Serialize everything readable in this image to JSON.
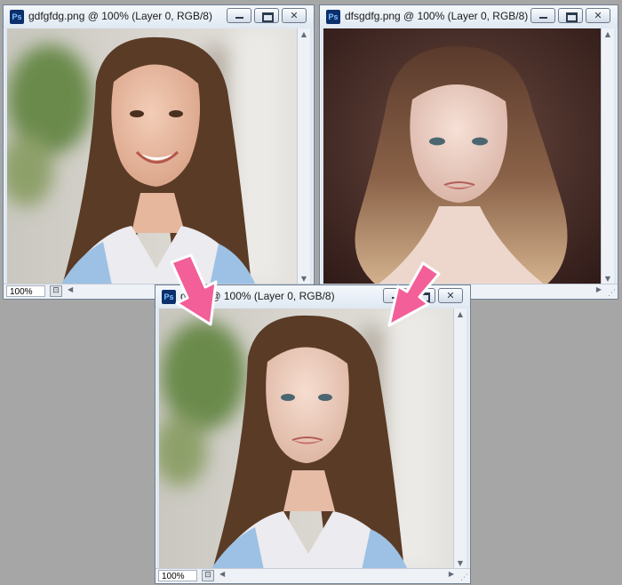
{
  "windows": [
    {
      "id": "win-source",
      "title": "gdfgfdg.png @ 100% (Layer 0, RGB/8)",
      "zoom": "100%",
      "icon": "photoshop-document-icon",
      "image": "portrait of smiling long-haired woman"
    },
    {
      "id": "win-face",
      "title": "dfsgdfg.png @ 100% (Layer 0, RGB/8)",
      "zoom": "",
      "icon": "photoshop-document-icon",
      "image": "portrait of woman with curly blonde-tipped hair"
    },
    {
      "id": "win-result",
      "title": "g.png @ 100% (Layer 0, RGB/8)",
      "zoom": "100%",
      "icon": "photoshop-document-icon",
      "image": "composited face-swapped portrait"
    }
  ],
  "window_buttons": {
    "minimize": "minimize-icon",
    "maximize": "maximize-icon",
    "close": "close-icon"
  },
  "colors": {
    "desktop": "#a6a6a6",
    "arrow": "#f25f99",
    "titlebar": "#dfe8f2"
  }
}
